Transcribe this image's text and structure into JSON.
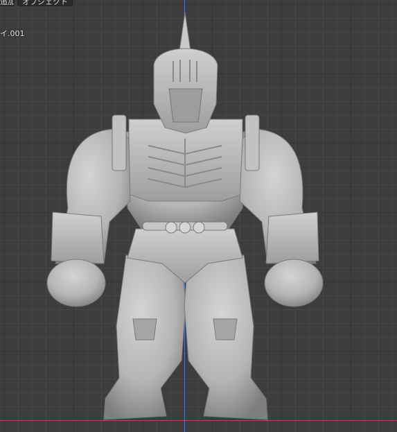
{
  "header": {
    "menu": [
      {
        "label": "追加"
      },
      {
        "label": "オブジェクト"
      }
    ]
  },
  "viewport": {
    "active_object": "イ.001"
  },
  "colors": {
    "background": "#3d3d3d",
    "grid": "#464646",
    "axis_y": "#4f7fd8",
    "axis_x": "#b0485a",
    "model": "#b9b9b9"
  }
}
